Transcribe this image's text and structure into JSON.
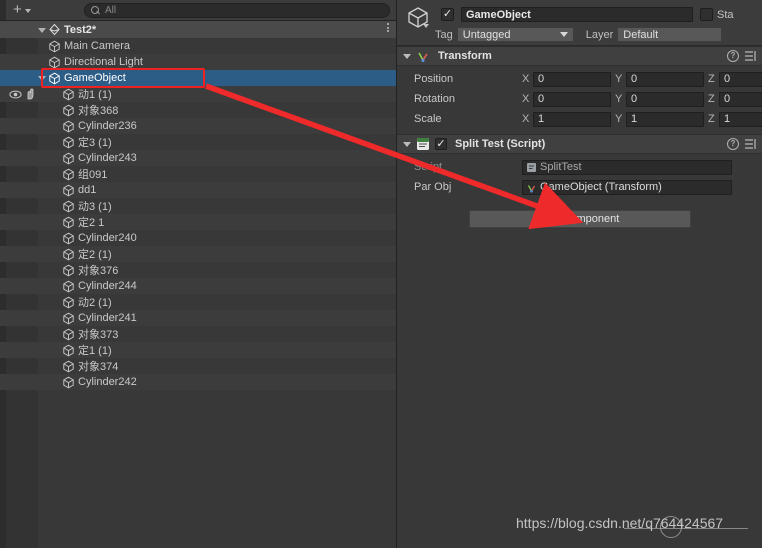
{
  "hierarchy": {
    "toolbar": {
      "create_label": "+",
      "search_placeholder": "All",
      "search_value": "All"
    },
    "scene_name": "Test2*",
    "items": [
      {
        "label": "Main Camera",
        "indent": 1,
        "expandable": false,
        "selected": false
      },
      {
        "label": "Directional Light",
        "indent": 1,
        "expandable": false,
        "selected": false
      },
      {
        "label": "GameObject",
        "indent": 1,
        "expandable": true,
        "selected": true
      },
      {
        "label": "动1 (1)",
        "indent": 2,
        "expandable": false,
        "selected": false
      },
      {
        "label": "对象368",
        "indent": 2,
        "expandable": false,
        "selected": false
      },
      {
        "label": "Cylinder236",
        "indent": 2,
        "expandable": false,
        "selected": false
      },
      {
        "label": "定3 (1)",
        "indent": 2,
        "expandable": false,
        "selected": false
      },
      {
        "label": "Cylinder243",
        "indent": 2,
        "expandable": false,
        "selected": false
      },
      {
        "label": "组091",
        "indent": 2,
        "expandable": false,
        "selected": false
      },
      {
        "label": "dd1",
        "indent": 2,
        "expandable": false,
        "selected": false
      },
      {
        "label": "动3 (1)",
        "indent": 2,
        "expandable": false,
        "selected": false
      },
      {
        "label": "定2 1",
        "indent": 2,
        "expandable": false,
        "selected": false
      },
      {
        "label": "Cylinder240",
        "indent": 2,
        "expandable": false,
        "selected": false
      },
      {
        "label": "定2 (1)",
        "indent": 2,
        "expandable": false,
        "selected": false
      },
      {
        "label": "对象376",
        "indent": 2,
        "expandable": false,
        "selected": false
      },
      {
        "label": "Cylinder244",
        "indent": 2,
        "expandable": false,
        "selected": false
      },
      {
        "label": "动2 (1)",
        "indent": 2,
        "expandable": false,
        "selected": false
      },
      {
        "label": "Cylinder241",
        "indent": 2,
        "expandable": false,
        "selected": false
      },
      {
        "label": "对象373",
        "indent": 2,
        "expandable": false,
        "selected": false
      },
      {
        "label": "定1 (1)",
        "indent": 2,
        "expandable": false,
        "selected": false
      },
      {
        "label": "对象374",
        "indent": 2,
        "expandable": false,
        "selected": false
      },
      {
        "label": "Cylinder242",
        "indent": 2,
        "expandable": false,
        "selected": false
      }
    ]
  },
  "inspector": {
    "object_name": "GameObject",
    "object_enabled": true,
    "static_label": "Sta",
    "static_checked": false,
    "tag_label": "Tag",
    "tag_value": "Untagged",
    "layer_label": "Layer",
    "layer_value": "Default",
    "transform": {
      "title": "Transform",
      "rows": [
        {
          "label": "Position",
          "x": "0",
          "y": "0",
          "z": "0"
        },
        {
          "label": "Rotation",
          "x": "0",
          "y": "0",
          "z": "0"
        },
        {
          "label": "Scale",
          "x": "1",
          "y": "1",
          "z": "1"
        }
      ],
      "axis_x": "X",
      "axis_y": "Y",
      "axis_z": "Z"
    },
    "script_component": {
      "title": "Split Test (Script)",
      "enabled": true,
      "script_label": "Script",
      "script_value": "SplitTest",
      "parobj_label": "Par Obj",
      "parobj_value": "GameObject (Transform)"
    },
    "add_component_label": "Add Component"
  },
  "annotations": {
    "watermark": "https://blog.csdn.net/q764424567",
    "highlight_color": "#ef2020",
    "arrow_color": "#ef2a2a"
  }
}
